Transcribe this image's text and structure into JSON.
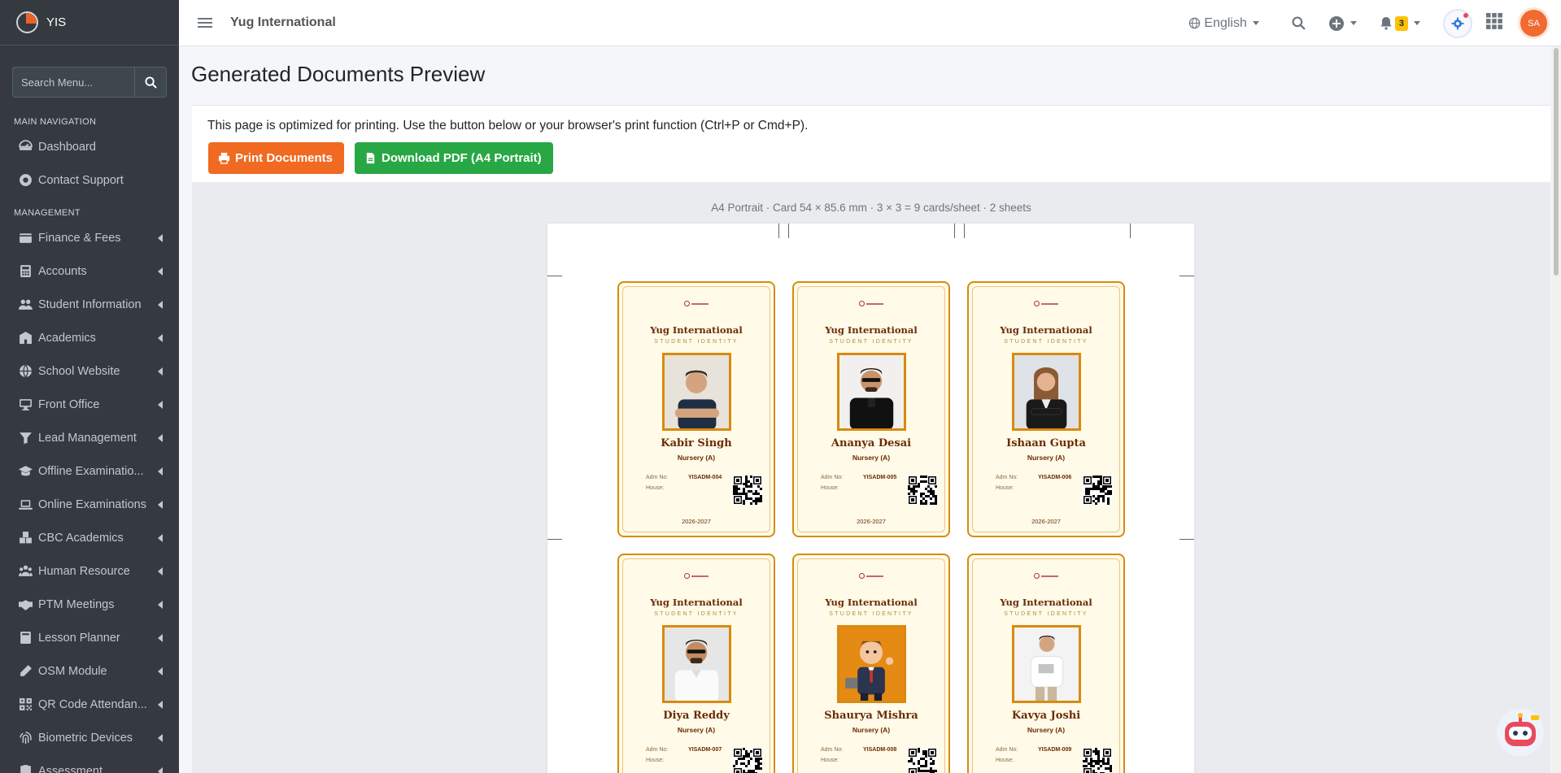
{
  "brand": {
    "name": "YIS"
  },
  "sidebar": {
    "search_placeholder": "Search Menu...",
    "main_header": "MAIN NAVIGATION",
    "main_items": [
      {
        "label": "Dashboard",
        "icon": "dashboard-icon"
      },
      {
        "label": "Contact Support",
        "icon": "support-icon"
      }
    ],
    "management_header": "MANAGEMENT",
    "items": [
      {
        "label": "Finance & Fees",
        "icon": "wallet-icon"
      },
      {
        "label": "Accounts",
        "icon": "calculator-icon"
      },
      {
        "label": "Student Information",
        "icon": "users-icon"
      },
      {
        "label": "Academics",
        "icon": "school-icon"
      },
      {
        "label": "School Website",
        "icon": "globe-icon"
      },
      {
        "label": "Front Office",
        "icon": "desktop-icon"
      },
      {
        "label": "Lead Management",
        "icon": "funnel-icon"
      },
      {
        "label": "Offline Examinatio...",
        "icon": "graduation-cap-icon"
      },
      {
        "label": "Online Examinations",
        "icon": "laptop-icon"
      },
      {
        "label": "CBC Academics",
        "icon": "cubes-icon"
      },
      {
        "label": "Human Resource",
        "icon": "people-group-icon"
      },
      {
        "label": "PTM Meetings",
        "icon": "handshake-icon"
      },
      {
        "label": "Lesson Planner",
        "icon": "book-icon"
      },
      {
        "label": "OSM Module",
        "icon": "pen-icon"
      },
      {
        "label": "QR Code Attendan...",
        "icon": "qrcode-icon"
      },
      {
        "label": "Biometric Devices",
        "icon": "fingerprint-icon"
      },
      {
        "label": "Assessment",
        "icon": "clipboard-icon"
      }
    ]
  },
  "topbar": {
    "school_name": "Yug International",
    "language": "English",
    "notification_count": "3",
    "avatar_initials": "SA"
  },
  "page": {
    "title": "Generated Documents Preview",
    "info": "This page is optimized for printing. Use the button below or your browser's print function (Ctrl+P or Cmd+P).",
    "print_label": "Print Documents",
    "pdf_label": "Download PDF (A4 Portrait)",
    "sheet_meta": "A4 Portrait · Card 54 × 85.6 mm · 3 × 3 = 9 cards/sheet · 2 sheets"
  },
  "cards": [
    {
      "school": "Yug International",
      "subtitle": "STUDENT IDENTITY",
      "name": "Kabir Singh",
      "class": "Nursery (A)",
      "adm_label": "Adm No:",
      "adm_no": "YISADM-004",
      "house_label": "House:",
      "year": "2026-2027",
      "photo": "man-navy-tee"
    },
    {
      "school": "Yug International",
      "subtitle": "STUDENT IDENTITY",
      "name": "Ananya Desai",
      "class": "Nursery (A)",
      "adm_label": "Adm No:",
      "adm_no": "YISADM-005",
      "house_label": "House:",
      "year": "2026-2027",
      "photo": "man-black-polo"
    },
    {
      "school": "Yug International",
      "subtitle": "STUDENT IDENTITY",
      "name": "Ishaan Gupta",
      "class": "Nursery (A)",
      "adm_label": "Adm No:",
      "adm_no": "YISADM-006",
      "house_label": "House:",
      "year": "2026-2027",
      "photo": "woman-blazer"
    },
    {
      "school": "Yug International",
      "subtitle": "STUDENT IDENTITY",
      "name": "Diya Reddy",
      "class": "Nursery (A)",
      "adm_label": "Adm No:",
      "adm_no": "YISADM-007",
      "house_label": "House:",
      "year": "",
      "photo": "man-white-polo"
    },
    {
      "school": "Yug International",
      "subtitle": "STUDENT IDENTITY",
      "name": "Shaurya Mishra",
      "class": "Nursery (A)",
      "adm_label": "Adm No:",
      "adm_no": "YISADM-008",
      "house_label": "House:",
      "year": "",
      "photo": "cartoon-businessman"
    },
    {
      "school": "Yug International",
      "subtitle": "STUDENT IDENTITY",
      "name": "Kavya Joshi",
      "class": "Nursery (A)",
      "adm_label": "Adm No:",
      "adm_no": "YISADM-009",
      "house_label": "House:",
      "year": "",
      "photo": "man-white-tee"
    }
  ],
  "colors": {
    "sidebar": "#343a40",
    "print_button": "#f06a22",
    "pdf_button": "#28a745",
    "card_border": "#d98a10",
    "card_bg": "#fffbe8"
  }
}
